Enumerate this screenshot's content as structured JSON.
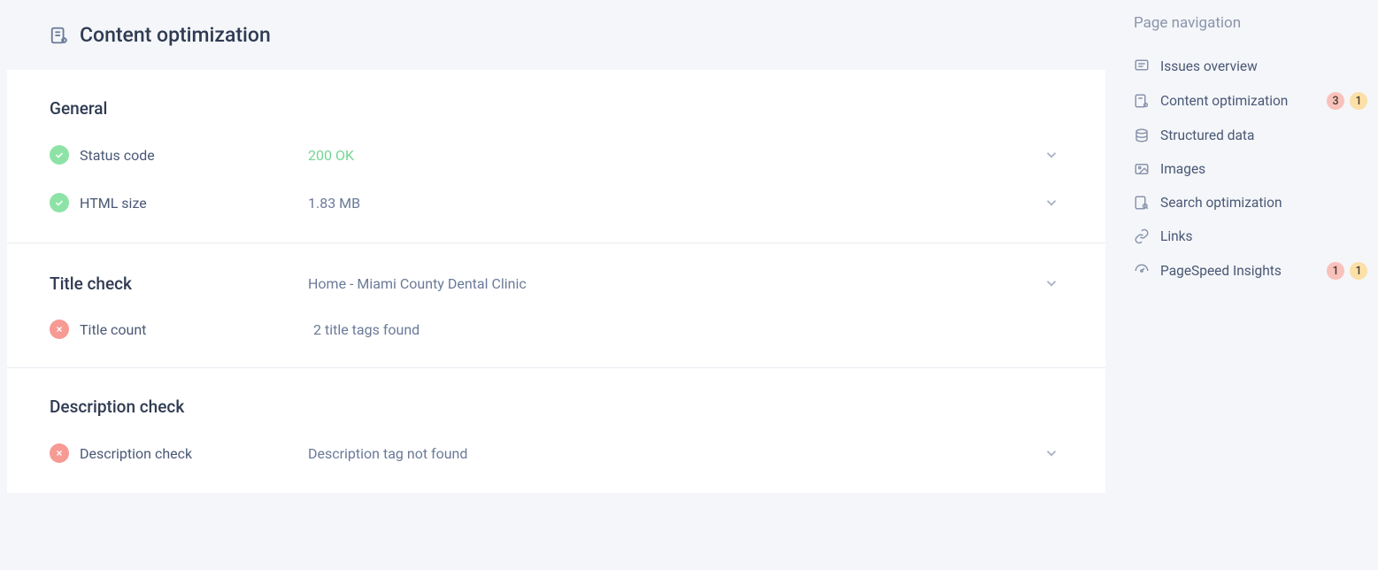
{
  "header": {
    "title": "Content optimization"
  },
  "sections": {
    "general": {
      "heading": "General",
      "status_code": {
        "label": "Status code",
        "value": "200 OK"
      },
      "html_size": {
        "label": "HTML size",
        "value": "1.83 MB"
      }
    },
    "title_check": {
      "heading": "Title check",
      "heading_value": "Home - Miami County Dental Clinic",
      "title_count": {
        "label": "Title count",
        "value": "2 title tags found"
      }
    },
    "description_check": {
      "heading": "Description check",
      "row": {
        "label": "Description check",
        "value": "Description tag not found"
      }
    }
  },
  "sidebar": {
    "title": "Page navigation",
    "items": [
      {
        "label": "Issues overview"
      },
      {
        "label": "Content optimization",
        "badge_red": "3",
        "badge_yellow": "1"
      },
      {
        "label": "Structured data"
      },
      {
        "label": "Images"
      },
      {
        "label": "Search optimization"
      },
      {
        "label": "Links"
      },
      {
        "label": "PageSpeed Insights",
        "badge_red": "1",
        "badge_yellow": "1"
      }
    ]
  }
}
